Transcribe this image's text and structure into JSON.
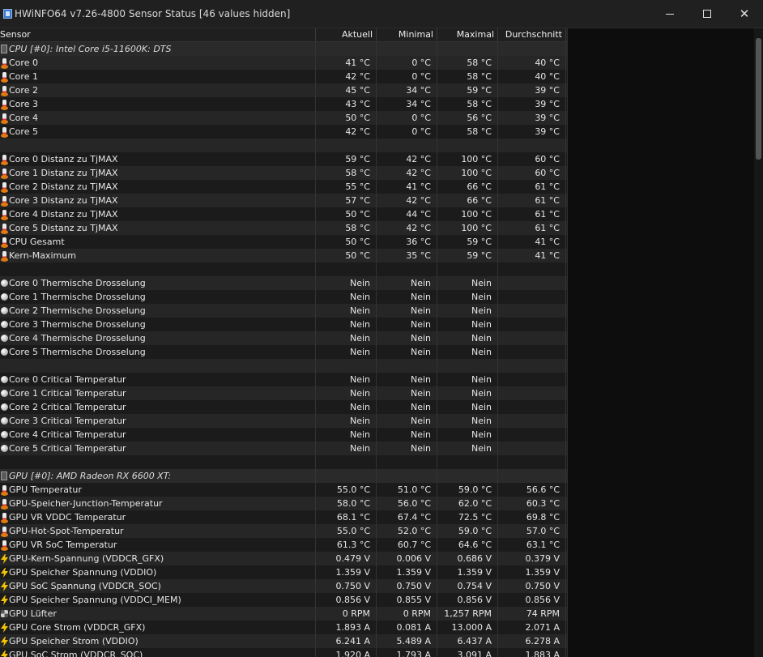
{
  "window": {
    "title": "HWiNFO64 v7.26-4800 Sensor Status [46 values hidden]"
  },
  "columns": {
    "sensor": "Sensor",
    "current": "Aktuell",
    "minimal": "Minimal",
    "maximal": "Maximal",
    "average": "Durchschnitt"
  },
  "rows": [
    {
      "type": "group",
      "icon": "chip-icon",
      "name": "CPU [#0]: Intel Core i5-11600K: DTS"
    },
    {
      "type": "data",
      "icon": "thermometer-icon",
      "name": "Core 0",
      "cur": "41 °C",
      "min": "0 °C",
      "max": "58 °C",
      "avg": "40 °C"
    },
    {
      "type": "data",
      "icon": "thermometer-icon",
      "name": "Core 1",
      "cur": "42 °C",
      "min": "0 °C",
      "max": "58 °C",
      "avg": "40 °C"
    },
    {
      "type": "data",
      "icon": "thermometer-icon",
      "name": "Core 2",
      "cur": "45 °C",
      "min": "34 °C",
      "max": "59 °C",
      "avg": "39 °C"
    },
    {
      "type": "data",
      "icon": "thermometer-icon",
      "name": "Core 3",
      "cur": "43 °C",
      "min": "34 °C",
      "max": "58 °C",
      "avg": "39 °C"
    },
    {
      "type": "data",
      "icon": "thermometer-icon",
      "name": "Core 4",
      "cur": "50 °C",
      "min": "0 °C",
      "max": "56 °C",
      "avg": "39 °C"
    },
    {
      "type": "data",
      "icon": "thermometer-icon",
      "name": "Core 5",
      "cur": "42 °C",
      "min": "0 °C",
      "max": "58 °C",
      "avg": "39 °C"
    },
    {
      "type": "blank"
    },
    {
      "type": "data",
      "icon": "thermometer-icon",
      "name": "Core 0 Distanz zu TjMAX",
      "cur": "59 °C",
      "min": "42 °C",
      "max": "100 °C",
      "avg": "60 °C"
    },
    {
      "type": "data",
      "icon": "thermometer-icon",
      "name": "Core 1 Distanz zu TjMAX",
      "cur": "58 °C",
      "min": "42 °C",
      "max": "100 °C",
      "avg": "60 °C"
    },
    {
      "type": "data",
      "icon": "thermometer-icon",
      "name": "Core 2 Distanz zu TjMAX",
      "cur": "55 °C",
      "min": "41 °C",
      "max": "66 °C",
      "avg": "61 °C"
    },
    {
      "type": "data",
      "icon": "thermometer-icon",
      "name": "Core 3 Distanz zu TjMAX",
      "cur": "57 °C",
      "min": "42 °C",
      "max": "66 °C",
      "avg": "61 °C"
    },
    {
      "type": "data",
      "icon": "thermometer-icon",
      "name": "Core 4 Distanz zu TjMAX",
      "cur": "50 °C",
      "min": "44 °C",
      "max": "100 °C",
      "avg": "61 °C"
    },
    {
      "type": "data",
      "icon": "thermometer-icon",
      "name": "Core 5 Distanz zu TjMAX",
      "cur": "58 °C",
      "min": "42 °C",
      "max": "100 °C",
      "avg": "61 °C"
    },
    {
      "type": "data",
      "icon": "thermometer-icon",
      "name": "CPU Gesamt",
      "cur": "50 °C",
      "min": "36 °C",
      "max": "59 °C",
      "avg": "41 °C"
    },
    {
      "type": "data",
      "icon": "thermometer-icon",
      "name": "Kern-Maximum",
      "cur": "50 °C",
      "min": "35 °C",
      "max": "59 °C",
      "avg": "41 °C"
    },
    {
      "type": "blank"
    },
    {
      "type": "data",
      "icon": "status-circle-icon",
      "name": "Core 0 Thermische Drosselung",
      "cur": "Nein",
      "min": "Nein",
      "max": "Nein",
      "avg": ""
    },
    {
      "type": "data",
      "icon": "status-circle-icon",
      "name": "Core 1 Thermische Drosselung",
      "cur": "Nein",
      "min": "Nein",
      "max": "Nein",
      "avg": ""
    },
    {
      "type": "data",
      "icon": "status-circle-icon",
      "name": "Core 2 Thermische Drosselung",
      "cur": "Nein",
      "min": "Nein",
      "max": "Nein",
      "avg": ""
    },
    {
      "type": "data",
      "icon": "status-circle-icon",
      "name": "Core 3 Thermische Drosselung",
      "cur": "Nein",
      "min": "Nein",
      "max": "Nein",
      "avg": ""
    },
    {
      "type": "data",
      "icon": "status-circle-icon",
      "name": "Core 4 Thermische Drosselung",
      "cur": "Nein",
      "min": "Nein",
      "max": "Nein",
      "avg": ""
    },
    {
      "type": "data",
      "icon": "status-circle-icon",
      "name": "Core 5 Thermische Drosselung",
      "cur": "Nein",
      "min": "Nein",
      "max": "Nein",
      "avg": ""
    },
    {
      "type": "blank"
    },
    {
      "type": "data",
      "icon": "status-circle-icon",
      "name": "Core 0 Critical Temperatur",
      "cur": "Nein",
      "min": "Nein",
      "max": "Nein",
      "avg": ""
    },
    {
      "type": "data",
      "icon": "status-circle-icon",
      "name": "Core 1 Critical Temperatur",
      "cur": "Nein",
      "min": "Nein",
      "max": "Nein",
      "avg": ""
    },
    {
      "type": "data",
      "icon": "status-circle-icon",
      "name": "Core 2 Critical Temperatur",
      "cur": "Nein",
      "min": "Nein",
      "max": "Nein",
      "avg": ""
    },
    {
      "type": "data",
      "icon": "status-circle-icon",
      "name": "Core 3 Critical Temperatur",
      "cur": "Nein",
      "min": "Nein",
      "max": "Nein",
      "avg": ""
    },
    {
      "type": "data",
      "icon": "status-circle-icon",
      "name": "Core 4 Critical Temperatur",
      "cur": "Nein",
      "min": "Nein",
      "max": "Nein",
      "avg": ""
    },
    {
      "type": "data",
      "icon": "status-circle-icon",
      "name": "Core 5 Critical Temperatur",
      "cur": "Nein",
      "min": "Nein",
      "max": "Nein",
      "avg": ""
    },
    {
      "type": "blank"
    },
    {
      "type": "group",
      "icon": "chip-icon",
      "name": "GPU [#0]: AMD Radeon RX 6600 XT:"
    },
    {
      "type": "data",
      "icon": "thermometer-icon",
      "name": "GPU Temperatur",
      "cur": "55.0 °C",
      "min": "51.0 °C",
      "max": "59.0 °C",
      "avg": "56.6 °C"
    },
    {
      "type": "data",
      "icon": "thermometer-icon",
      "name": "GPU-Speicher-Junction-Temperatur",
      "cur": "58.0 °C",
      "min": "56.0 °C",
      "max": "62.0 °C",
      "avg": "60.3 °C"
    },
    {
      "type": "data",
      "icon": "thermometer-icon",
      "name": "GPU VR VDDC Temperatur",
      "cur": "68.1 °C",
      "min": "67.4 °C",
      "max": "72.5 °C",
      "avg": "69.8 °C"
    },
    {
      "type": "data",
      "icon": "thermometer-icon",
      "name": "GPU-Hot-Spot-Temperatur",
      "cur": "55.0 °C",
      "min": "52.0 °C",
      "max": "59.0 °C",
      "avg": "57.0 °C"
    },
    {
      "type": "data",
      "icon": "thermometer-icon",
      "name": "GPU VR SoC Temperatur",
      "cur": "61.3 °C",
      "min": "60.7 °C",
      "max": "64.6 °C",
      "avg": "63.1 °C"
    },
    {
      "type": "data",
      "icon": "lightning-icon",
      "name": "GPU-Kern-Spannung (VDDCR_GFX)",
      "cur": "0.479 V",
      "min": "0.006 V",
      "max": "0.686 V",
      "avg": "0.379 V"
    },
    {
      "type": "data",
      "icon": "lightning-icon",
      "name": "GPU Speicher Spannung (VDDIO)",
      "cur": "1.359 V",
      "min": "1.359 V",
      "max": "1.359 V",
      "avg": "1.359 V"
    },
    {
      "type": "data",
      "icon": "lightning-icon",
      "name": "GPU SoC Spannung (VDDCR_SOC)",
      "cur": "0.750 V",
      "min": "0.750 V",
      "max": "0.754 V",
      "avg": "0.750 V"
    },
    {
      "type": "data",
      "icon": "lightning-icon",
      "name": "GPU Speicher Spannung (VDDCI_MEM)",
      "cur": "0.856 V",
      "min": "0.855 V",
      "max": "0.856 V",
      "avg": "0.856 V"
    },
    {
      "type": "data",
      "icon": "fan-icon",
      "name": "GPU Lüfter",
      "cur": "0 RPM",
      "min": "0 RPM",
      "max": "1,257 RPM",
      "avg": "74 RPM"
    },
    {
      "type": "data",
      "icon": "lightning-icon",
      "name": "GPU Core Strom (VDDCR_GFX)",
      "cur": "1.893 A",
      "min": "0.081 A",
      "max": "13.000 A",
      "avg": "2.071 A"
    },
    {
      "type": "data",
      "icon": "lightning-icon",
      "name": "GPU Speicher Strom (VDDIO)",
      "cur": "6.241 A",
      "min": "5.489 A",
      "max": "6.437 A",
      "avg": "6.278 A"
    },
    {
      "type": "data",
      "icon": "lightning-icon",
      "name": "GPU SoC Strom (VDDCR_SOC)",
      "cur": "1.920 A",
      "min": "1.793 A",
      "max": "3.091 A",
      "avg": "1.883 A"
    }
  ]
}
